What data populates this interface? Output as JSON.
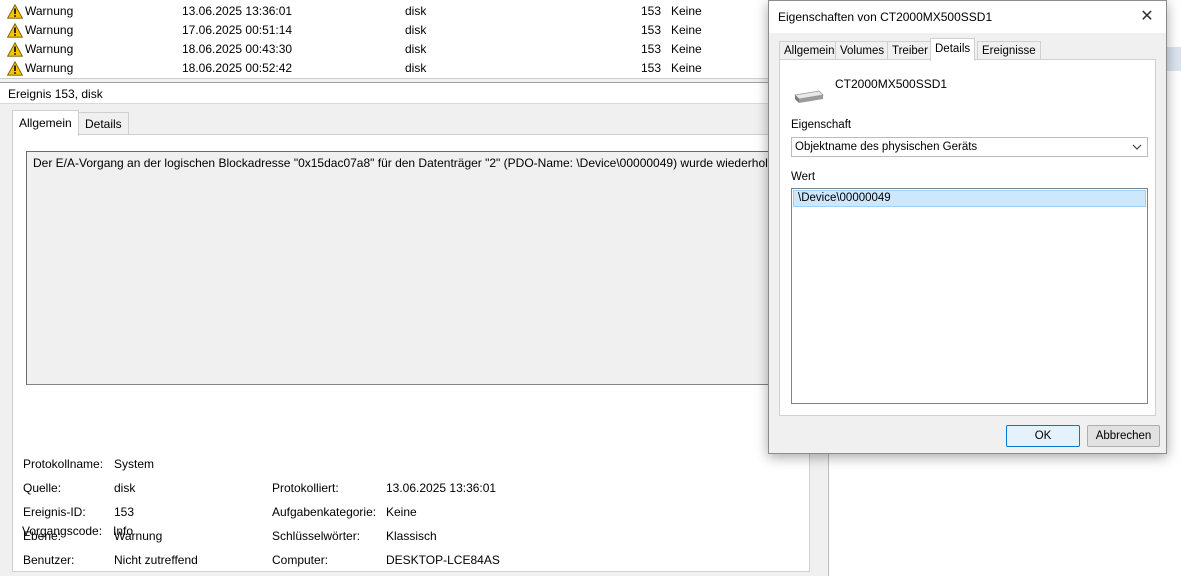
{
  "event_list": {
    "rows": [
      {
        "level": "Warnung",
        "date": "13.06.2025 13:36:01",
        "source": "disk",
        "id": "153",
        "category": "Keine"
      },
      {
        "level": "Warnung",
        "date": "17.06.2025 00:51:14",
        "source": "disk",
        "id": "153",
        "category": "Keine"
      },
      {
        "level": "Warnung",
        "date": "18.06.2025 00:43:30",
        "source": "disk",
        "id": "153",
        "category": "Keine"
      },
      {
        "level": "Warnung",
        "date": "18.06.2025 00:52:42",
        "source": "disk",
        "id": "153",
        "category": "Keine"
      }
    ],
    "icon": "warning-icon"
  },
  "preview": {
    "header": "Ereignis 153, disk",
    "tabs": [
      "Allgemein",
      "Details"
    ],
    "message": "Der E/A-Vorgang an der logischen Blockadresse \"0x15dac07a8\" für den Datenträger \"2\" (PDO-Name: \\Device\\00000049) wurde wiederholt.",
    "fields": {
      "protokollname": {
        "label": "Protokollname:",
        "value": "System"
      },
      "quelle": {
        "label": "Quelle:",
        "value": "disk"
      },
      "ereignis_id": {
        "label": "Ereignis-ID:",
        "value": "153"
      },
      "ebene": {
        "label": "Ebene:",
        "value": "Warnung"
      },
      "benutzer": {
        "label": "Benutzer:",
        "value": "Nicht zutreffend"
      },
      "vorgangscode": {
        "label": "Vorgangscode:",
        "value": "Info"
      },
      "protokolliert": {
        "label": "Protokolliert:",
        "value": "13.06.2025 13:36:01"
      },
      "aufgabenkategorie": {
        "label": "Aufgabenkategorie:",
        "value": "Keine"
      },
      "schluesselwoerter": {
        "label": "Schlüsselwörter:",
        "value": "Klassisch"
      },
      "computer": {
        "label": "Computer:",
        "value": "DESKTOP-LCE84AS"
      }
    }
  },
  "dialog": {
    "title": "Eigenschaften von CT2000MX500SSD1",
    "close_glyph": "✕",
    "tabs": [
      "Allgemein",
      "Volumes",
      "Treiber",
      "Details",
      "Ereignisse"
    ],
    "active_tab": "Details",
    "device_name": "CT2000MX500SSD1",
    "property_label": "Eigenschaft",
    "property_selected": "Objektname des physischen Geräts",
    "value_label": "Wert",
    "value_item": "\\Device\\00000049",
    "ok_label": "OK",
    "cancel_label": "Abbrechen"
  },
  "colors": {
    "selection_bg": "#cce8ff",
    "ok_border": "#0078d7",
    "warning_yellow": "#f5c400"
  }
}
